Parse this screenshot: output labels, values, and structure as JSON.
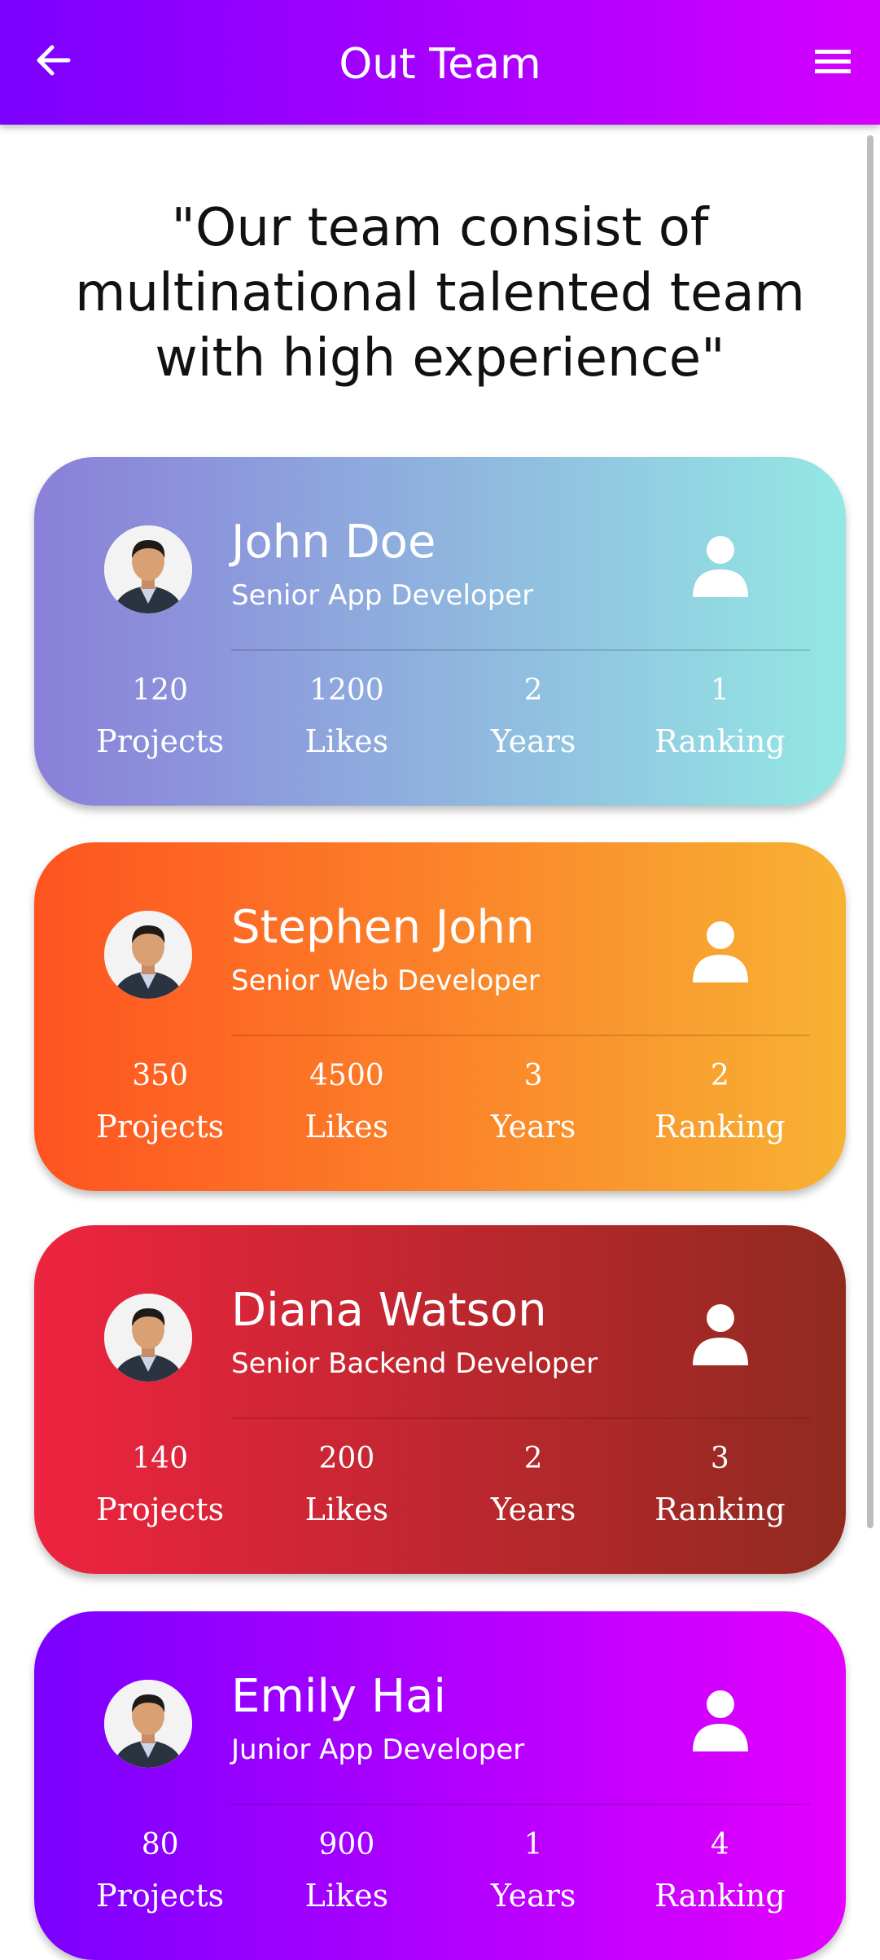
{
  "appbar": {
    "title": "Out Team",
    "back_icon": "arrow-left-icon",
    "menu_icon": "hamburger-menu-icon"
  },
  "intro": {
    "quote": "\"Our team consist of multinational talented team with high experience\""
  },
  "members": [
    {
      "name": "John Doe",
      "role": "Senior App Developer",
      "gradient": [
        "#8a7fd9",
        "#94e8e4"
      ],
      "stats": [
        {
          "value": "120",
          "label": "Projects"
        },
        {
          "value": "1200",
          "label": "Likes"
        },
        {
          "value": "2",
          "label": "Years"
        },
        {
          "value": "1",
          "label": "Ranking"
        }
      ]
    },
    {
      "name": "Stephen John",
      "role": "Senior Web Developer",
      "gradient": [
        "#ff5320",
        "#f7b233"
      ],
      "stats": [
        {
          "value": "350",
          "label": "Projects"
        },
        {
          "value": "4500",
          "label": "Likes"
        },
        {
          "value": "3",
          "label": "Years"
        },
        {
          "value": "2",
          "label": "Ranking"
        }
      ]
    },
    {
      "name": "Diana Watson",
      "role": "Senior Backend Developer",
      "gradient": [
        "#ee2440",
        "#902a1f"
      ],
      "stats": [
        {
          "value": "140",
          "label": "Projects"
        },
        {
          "value": "200",
          "label": "Likes"
        },
        {
          "value": "2",
          "label": "Years"
        },
        {
          "value": "3",
          "label": "Ranking"
        }
      ]
    },
    {
      "name": "Emily Hai",
      "role": "Junior App Developer",
      "gradient": [
        "#7b00ff",
        "#e300ff"
      ],
      "stats": [
        {
          "value": "80",
          "label": "Projects"
        },
        {
          "value": "900",
          "label": "Likes"
        },
        {
          "value": "1",
          "label": "Years"
        },
        {
          "value": "4",
          "label": "Ranking"
        }
      ]
    }
  ],
  "colors": {
    "appbar_start": "#7b00ff",
    "appbar_end": "#d300ff",
    "text_on_card": "#ffffff",
    "quote_text": "#111111"
  }
}
